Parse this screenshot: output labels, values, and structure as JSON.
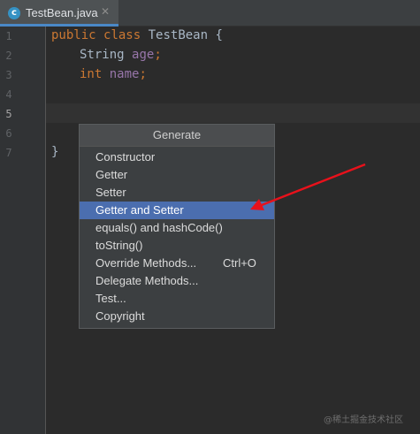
{
  "tab": {
    "icon_letter": "c",
    "label": "TestBean.java",
    "close": "✕"
  },
  "line_numbers": [
    "1",
    "2",
    "3",
    "4",
    "5",
    "6",
    "7"
  ],
  "code": {
    "line1": {
      "kw1": "public",
      "kw2": "class",
      "name": "TestBean",
      "brace": "{"
    },
    "line2": {
      "type": "String",
      "field": "age",
      "semi": ";"
    },
    "line3": {
      "type": "int",
      "field": "name",
      "semi": ";"
    },
    "line7": {
      "brace": "}"
    }
  },
  "popup": {
    "title": "Generate",
    "items": [
      {
        "label": "Constructor"
      },
      {
        "label": "Getter"
      },
      {
        "label": "Setter"
      },
      {
        "label": "Getter and Setter",
        "selected": true
      },
      {
        "label": "equals() and hashCode()"
      },
      {
        "label": "toString()"
      },
      {
        "label": "Override Methods...",
        "shortcut": "Ctrl+O"
      },
      {
        "label": "Delegate Methods..."
      },
      {
        "label": "Test..."
      },
      {
        "label": "Copyright"
      }
    ]
  },
  "annotation": {
    "arrow_color": "#e8111b"
  },
  "watermark": "@稀土掘金技术社区",
  "colors": {
    "editor_bg": "#2b2b2b",
    "keyword": "#cc7832",
    "field": "#9876aa",
    "selection": "#4b6eaf"
  }
}
